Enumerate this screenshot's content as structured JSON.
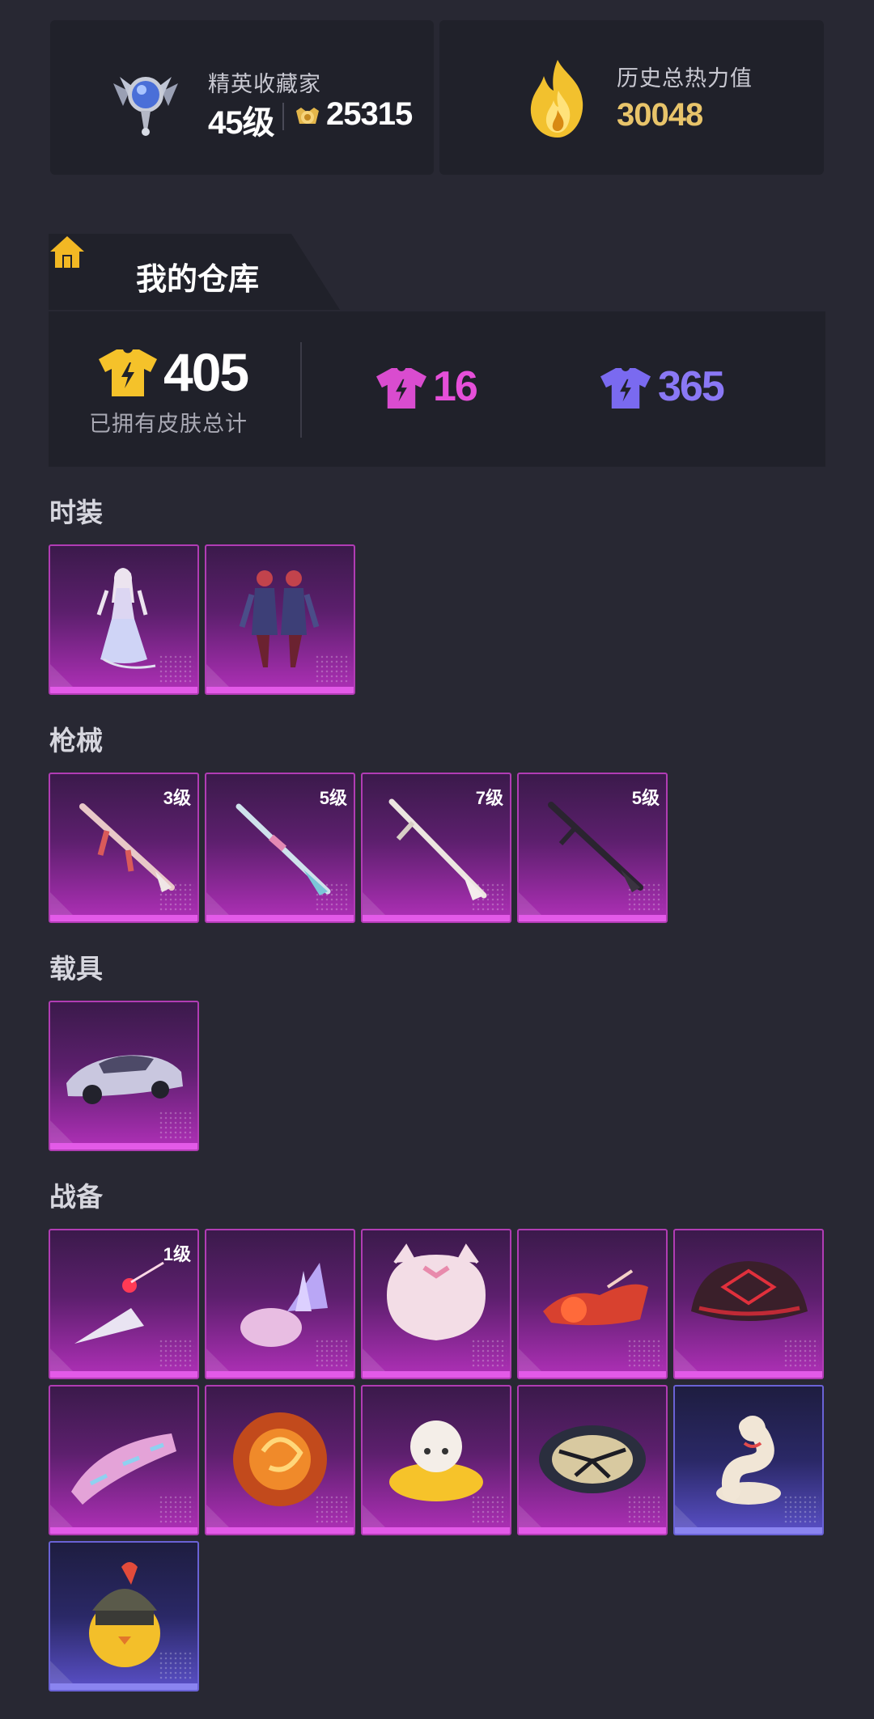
{
  "collector": {
    "title": "精英收藏家",
    "level": "45级",
    "coins": "25315"
  },
  "heat": {
    "title": "历史总热力值",
    "value": "30048"
  },
  "warehouse": {
    "title": "我的仓库",
    "total": "405",
    "total_label": "已拥有皮肤总计",
    "legendary_count": "16",
    "epic_count": "365"
  },
  "sections": {
    "outfits": "时装",
    "guns": "枪械",
    "vehicles": "载具",
    "gear": "战备"
  },
  "guns": [
    {
      "level": "3级"
    },
    {
      "level": "5级"
    },
    {
      "level": "7级"
    },
    {
      "level": "5级"
    }
  ],
  "gear": [
    {
      "level": "1级"
    }
  ],
  "colors": {
    "background": "#282833",
    "card": "#20212a",
    "gold": "#e8c46a",
    "pink": "#e64fd9",
    "purple": "#8a78f5"
  },
  "icons": [
    "badge-icon",
    "flame-icon",
    "coin-icon",
    "home-icon",
    "shirt-icon"
  ]
}
